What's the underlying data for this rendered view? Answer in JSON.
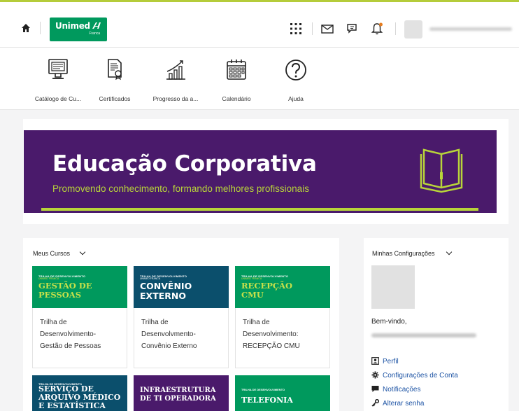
{
  "header": {
    "logo_text": "Unimed",
    "logo_sub": "Franca"
  },
  "nav": {
    "items": [
      {
        "label": "Catálogo de Cu..."
      },
      {
        "label": "Certificados"
      },
      {
        "label": "Progresso da a..."
      },
      {
        "label": "Calendário"
      },
      {
        "label": "Ajuda"
      }
    ]
  },
  "banner": {
    "title": "Educação Corporativa",
    "subtitle": "Promovendo conhecimento, formando melhores profissionais"
  },
  "courses": {
    "title": "Meus Cursos",
    "cards": [
      {
        "thumb_small": "TRILHA DE DESENVOLVIMENTO",
        "thumb_small2": "UNIMED FRANCA",
        "thumb_title": "GESTÃO DE\nPESSOAS",
        "desc": "Trilha de\nDesenvolvimento-\nGestão de Pessoas",
        "color": "#00995d"
      },
      {
        "thumb_small": "TRILHA DE DESENVOLVIMENTO",
        "thumb_small2": "UNIMED FRANCA",
        "thumb_title": "CONVÊNIO\nEXTERNO",
        "desc": "Trilha de\nDesenvolvmento-\nConvênio Externo",
        "color": "#0b4f6c"
      },
      {
        "thumb_small": "TRILHA DE DESENVOLVIMENTO",
        "thumb_small2": "UNIMED FRANCA",
        "thumb_title": "RECEPÇÃO\nCMU",
        "desc": "Trilha de\nDesenvolvimento:\nRECEPÇÃO CMU",
        "color": "#00995d"
      }
    ],
    "row2": [
      {
        "thumb_small": "TRILHA DE DESENVOLVIMENTO",
        "thumb_title": "SERVIÇO DE\nARQUIVO MÉDICO\nE ESTATÍSTICA",
        "color": "#0b4f6c"
      },
      {
        "thumb_small": "",
        "thumb_title": "INFRAESTRUTURA\nDE TI OPERADORA",
        "color": "#4a1a6b"
      },
      {
        "thumb_small": "TRILHA DE DESENVOLVIMENTO",
        "thumb_title": "TELEFONIA",
        "color": "#00995d"
      }
    ]
  },
  "config": {
    "title": "Minhas Configurações",
    "welcome": "Bem-vindo,",
    "links": [
      {
        "label": "Perfil",
        "icon": "profile-icon"
      },
      {
        "label": "Configurações de Conta",
        "icon": "gear-icon"
      },
      {
        "label": "Notificações",
        "icon": "chat-icon"
      },
      {
        "label": "Alterar senha",
        "icon": "key-icon"
      }
    ]
  },
  "colors": {
    "brand_green": "#00995d",
    "accent_lime": "#b8d43a",
    "banner_purple": "#4a1a6b",
    "link_blue": "#1f55a5",
    "dark_teal": "#0b4f6c"
  }
}
